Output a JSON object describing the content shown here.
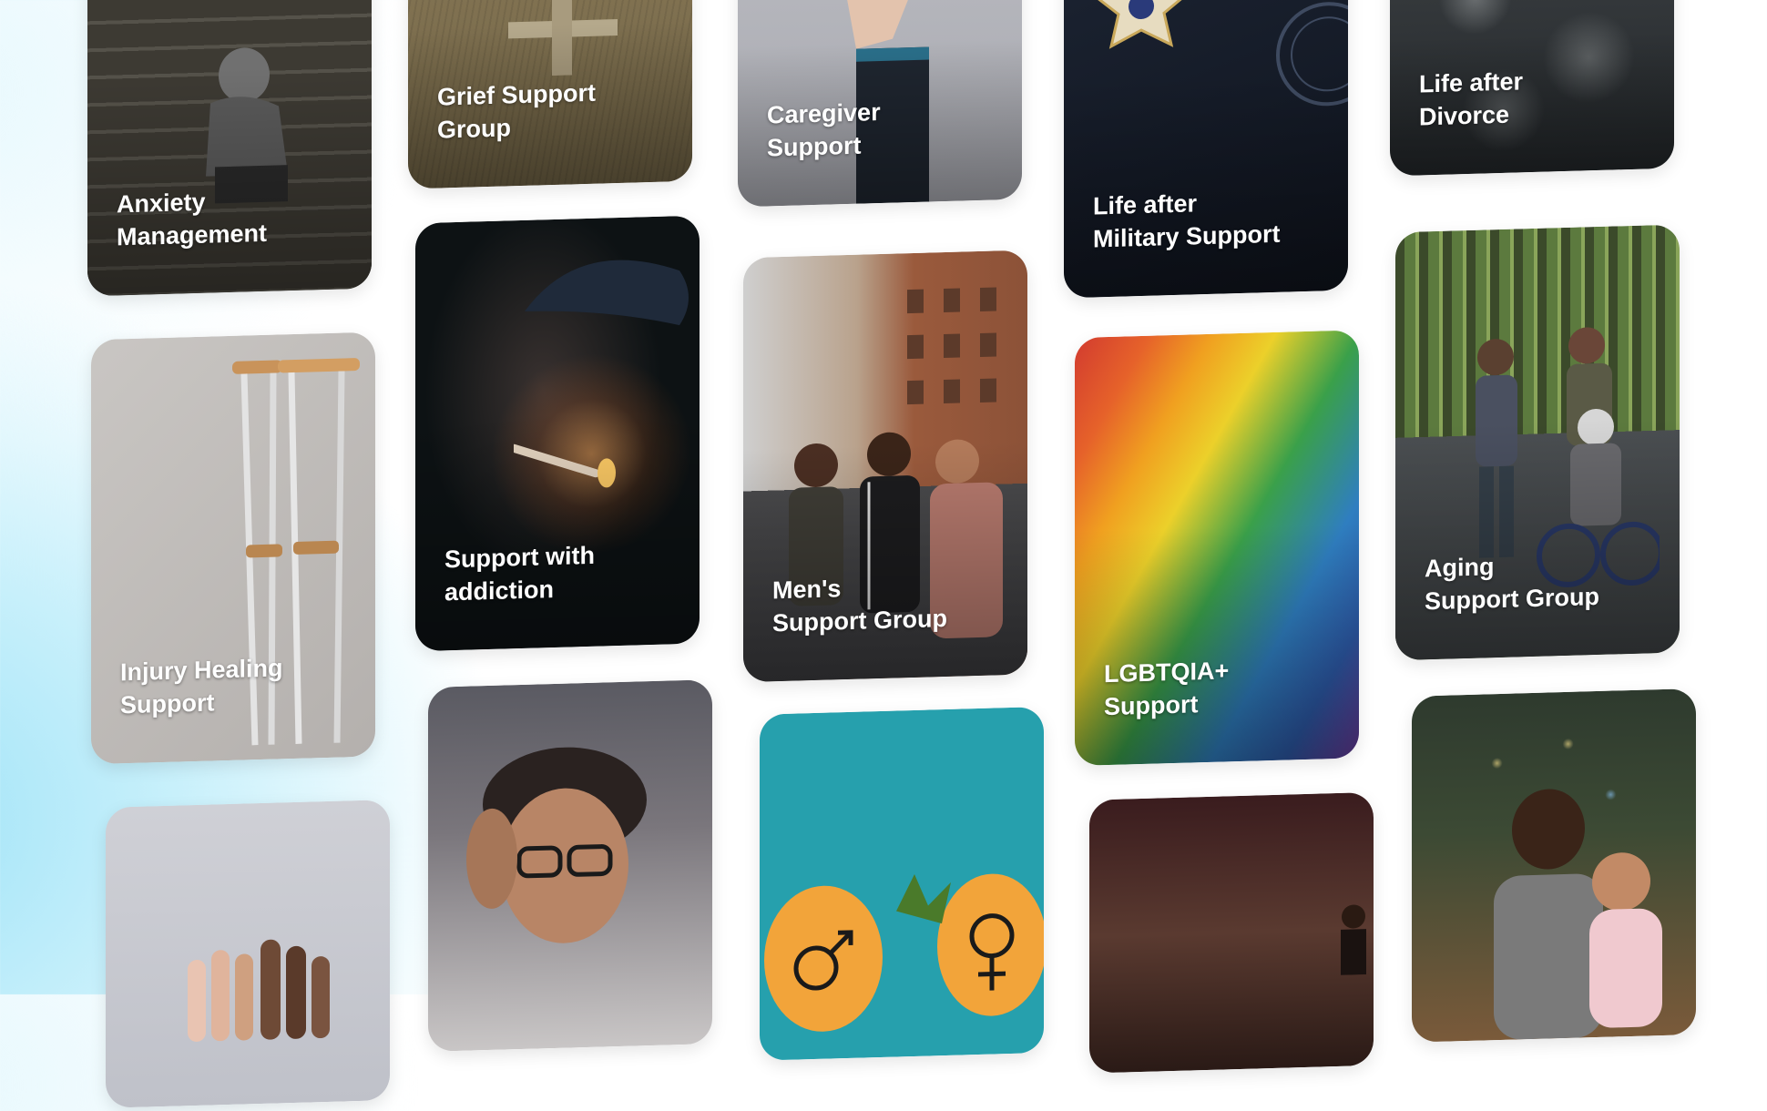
{
  "cards": [
    {
      "label": "Anxiety\nManagement"
    },
    {
      "label": "Injury Healing\nSupport"
    },
    {
      "label": ""
    },
    {
      "label": "Grief Support\nGroup"
    },
    {
      "label": "Support with\naddiction"
    },
    {
      "label": ""
    },
    {
      "label": "Caregiver\nSupport"
    },
    {
      "label": "Men's\nSupport Group"
    },
    {
      "label": ""
    },
    {
      "label": "Life after\nMilitary Support"
    },
    {
      "label": "LGBTQIA+\nSupport"
    },
    {
      "label": ""
    },
    {
      "label": "Life after\nDivorce"
    },
    {
      "label": "Aging\nSupport Group"
    },
    {
      "label": ""
    }
  ]
}
